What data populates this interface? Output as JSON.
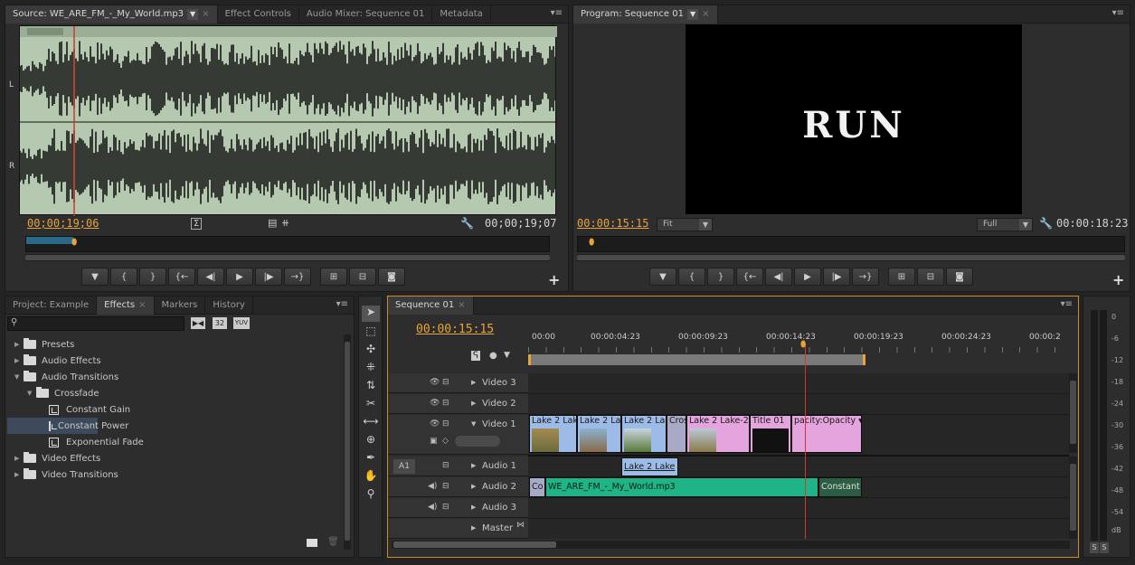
{
  "source_panel": {
    "tabs": [
      {
        "label": "Source: WE_ARE_FM_-_My_World.mp3"
      },
      {
        "label": "Effect Controls"
      },
      {
        "label": "Audio Mixer: Sequence 01"
      },
      {
        "label": "Metadata"
      }
    ],
    "channel_labels": [
      "L",
      "R"
    ],
    "playhead_tc": "00;00;19;06",
    "duration_tc": "00;00;19;07"
  },
  "program_panel": {
    "tab": "Program: Sequence 01",
    "frame_text": "RUN",
    "playhead_tc": "00:00:15:15",
    "fit_select": "Fit",
    "quality_select": "Full",
    "duration_tc": "00:00:18:23"
  },
  "project_panel": {
    "tabs": [
      {
        "label": "Project: Example"
      },
      {
        "label": "Effects"
      },
      {
        "label": "Markers"
      },
      {
        "label": "History"
      }
    ],
    "search_placeholder": "",
    "filter_badges": [
      "32",
      "YUV"
    ],
    "tree": [
      {
        "label": "Presets",
        "type": "folder",
        "depth": 0,
        "expanded": false
      },
      {
        "label": "Audio Effects",
        "type": "folder",
        "depth": 0,
        "expanded": false
      },
      {
        "label": "Audio Transitions",
        "type": "folder",
        "depth": 0,
        "expanded": true
      },
      {
        "label": "Crossfade",
        "type": "folder",
        "depth": 1,
        "expanded": true
      },
      {
        "label": "Constant Gain",
        "type": "effect",
        "depth": 2
      },
      {
        "label": "Constant Power",
        "type": "effect",
        "depth": 2,
        "selected": true
      },
      {
        "label": "Exponential Fade",
        "type": "effect",
        "depth": 2
      },
      {
        "label": "Video Effects",
        "type": "folder",
        "depth": 0,
        "expanded": false
      },
      {
        "label": "Video Transitions",
        "type": "folder",
        "depth": 0,
        "expanded": false
      }
    ]
  },
  "timeline": {
    "tab": "Sequence 01",
    "playhead_tc": "00:00:15:15",
    "ruler_labels": [
      "00:00",
      "00:00:04:23",
      "00:00:09:23",
      "00:00:14:23",
      "00:00:19:23",
      "00:00:24:23",
      "00:00:2"
    ],
    "tracks": [
      {
        "name": "Video 3"
      },
      {
        "name": "Video 2"
      },
      {
        "name": "Video 1"
      },
      {
        "name": "Audio 1",
        "label": "A1"
      },
      {
        "name": "Audio 2"
      },
      {
        "name": "Audio 3"
      },
      {
        "name": "Master"
      }
    ],
    "video1_clips": [
      {
        "label": "Lake 2 Lak"
      },
      {
        "label": "Lake 2 La"
      },
      {
        "label": "Lake 2 La"
      },
      {
        "label": "Cros"
      },
      {
        "label": "Lake 2 Lake-2"
      },
      {
        "label": "Title 01"
      },
      {
        "label": "pacity:Opacity ▾"
      }
    ],
    "audio1_clip": "Lake 2 Lake",
    "audio2_clip_pre": "Co",
    "audio2_clip": "WE_ARE_FM_-_My_World.mp3",
    "audio2_trans": "Constant"
  },
  "meter": {
    "ticks": [
      "0",
      "-6",
      "-12",
      "-18",
      "-24",
      "-30",
      "-36",
      "-42",
      "-48",
      "-54",
      "dB"
    ],
    "solo_buttons": [
      "S",
      "S"
    ]
  },
  "colors": {
    "timecode": "#e7a43b",
    "waveform_bg": "#b5c9b0",
    "audio_clip": "#1fb486",
    "video_clip": "#9cbbe6",
    "title_clip": "#e4a5df",
    "playhead": "#d03a2a"
  }
}
